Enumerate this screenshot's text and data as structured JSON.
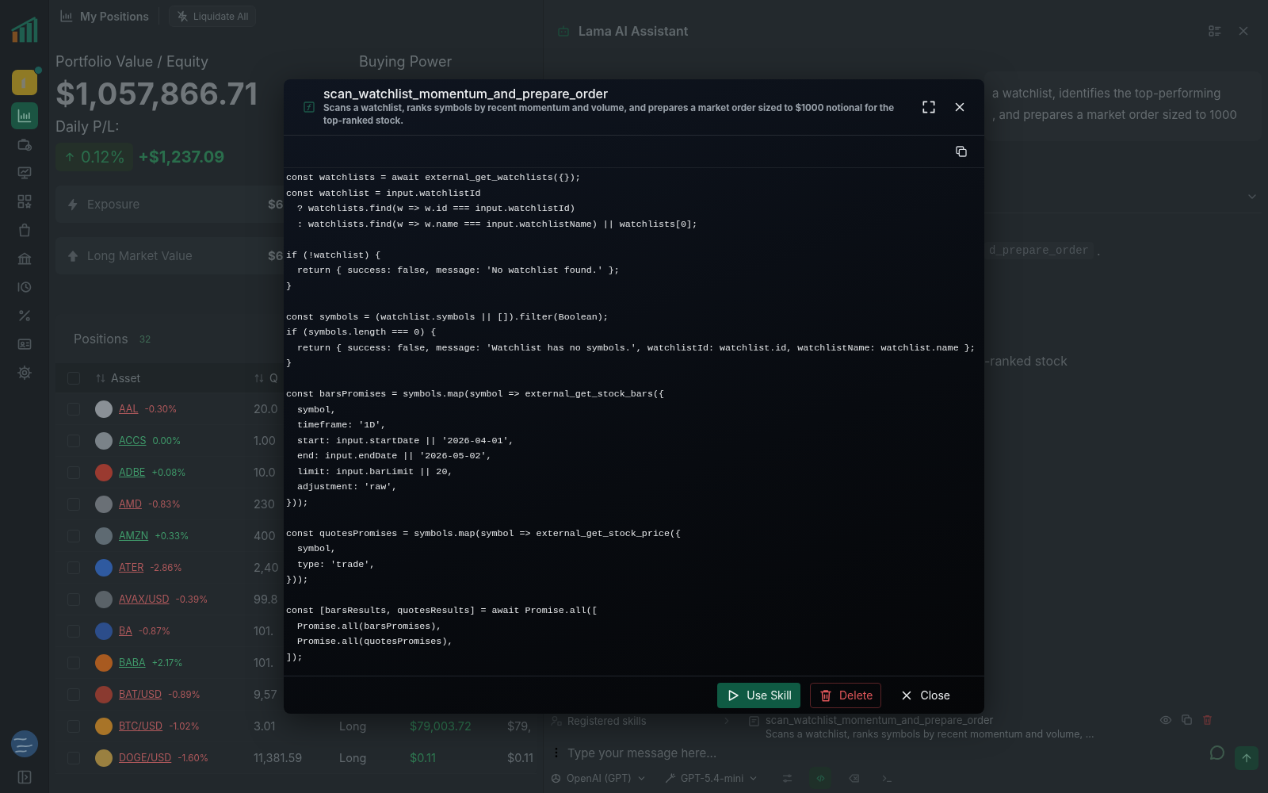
{
  "sidebar": {
    "items": [
      {
        "selected": true
      },
      {
        "selected": false
      },
      {
        "selected": false
      },
      {
        "selected": false
      },
      {
        "selected": false
      },
      {
        "selected": false
      },
      {
        "selected": false
      },
      {
        "selected": false
      },
      {
        "selected": false
      },
      {
        "selected": false
      }
    ]
  },
  "header": {
    "title": "My Positions",
    "liquidate_button": "Liquidate All"
  },
  "portfolio": {
    "label": "Portfolio Value / Equity",
    "value": "$1,057,866.71",
    "daily_label": "Daily P/L:",
    "change_percent": "0.12%",
    "change_amount": "+$1,237.09",
    "buying_power_label": "Buying Power"
  },
  "metrics": [
    {
      "kind": "exposure",
      "label": "Exposure",
      "value": "$6"
    },
    {
      "kind": "long",
      "label": "Long Market Value",
      "value": "$6"
    }
  ],
  "positions": {
    "title": "Positions",
    "count": "32",
    "header_checked": false,
    "columns": [
      "Asset",
      "Q"
    ],
    "rows": [
      {
        "symbol": "AAL",
        "change": "-0.30%",
        "color": "#b0595c",
        "checked": false,
        "quantity": "20.0"
      },
      {
        "symbol": "ACCS",
        "change": "0.00%",
        "color": "#3f9a6a",
        "checked": false,
        "quantity": "1.00"
      },
      {
        "symbol": "ADBE",
        "change": "+0.08%",
        "color": "#3f9a6a",
        "checked": false,
        "quantity": "10.0"
      },
      {
        "symbol": "AMD",
        "change": "-0.83%",
        "color": "#b0595c",
        "checked": false,
        "quantity": "230"
      },
      {
        "symbol": "AMZN",
        "change": "+0.33%",
        "color": "#3f9a6a",
        "checked": false,
        "quantity": "400"
      },
      {
        "symbol": "ATER",
        "change": "-2.86%",
        "color": "#b0595c",
        "checked": false,
        "quantity": "2,40"
      },
      {
        "symbol": "AVAX/USD",
        "change": "-0.39%",
        "color": "#b0595c",
        "checked": false,
        "quantity": "99.8"
      },
      {
        "symbol": "BA",
        "change": "-0.87%",
        "color": "#b0595c",
        "checked": false,
        "quantity": "101."
      },
      {
        "symbol": "BABA",
        "change": "+2.17%",
        "color": "#3f9a6a",
        "checked": false,
        "quantity": "101."
      },
      {
        "symbol": "BAT/USD",
        "change": "-0.89%",
        "color": "#b0595c",
        "checked": false,
        "quantity": "9,57"
      },
      {
        "symbol": "BTC/USD",
        "change": "-1.02%",
        "color": "#b0595c",
        "checked": false,
        "quantity": "3.01",
        "side": "Long",
        "price": "$79,003.72",
        "value": "$79,"
      },
      {
        "symbol": "DOGE/USD",
        "change": "-1.60%",
        "color": "#b0595c",
        "checked": false,
        "quantity": "11,381.59",
        "side": "Long",
        "price": "$0.11",
        "value": "$0.11"
      }
    ]
  },
  "assistant": {
    "title": "Lama AI Assistant",
    "message_lines": [
      "a watchlist, identifies the top-performing",
      ", and prepares a market order sized to 1000"
    ],
    "inline_code": "d_prepare_order",
    "inline_after": ".",
    "ranked_text": "-ranked stock",
    "skills_label": "Registered skills",
    "skill": {
      "name": "scan_watchlist_momentum_and_prepare_order",
      "description": "Scans a watchlist, ranks symbols by recent momentum and volume, ..."
    },
    "input_placeholder": "Type your message here...",
    "provider": "OpenAI (GPT)",
    "model": "GPT-5.4-mini",
    "tools": [
      {
        "selected": false
      },
      {
        "selected": true
      },
      {
        "selected": false
      },
      {
        "selected": false
      }
    ]
  },
  "modal": {
    "title": "scan_watchlist_momentum_and_prepare_order",
    "description": "Scans a watchlist, ranks symbols by recent momentum and volume, and prepares a market order sized to $1000 notional for the top-ranked stock.",
    "code": "const watchlists = await external_get_watchlists({});\nconst watchlist = input.watchlistId\n  ? watchlists.find(w => w.id === input.watchlistId)\n  : watchlists.find(w => w.name === input.watchlistName) || watchlists[0];\n\nif (!watchlist) {\n  return { success: false, message: 'No watchlist found.' };\n}\n\nconst symbols = (watchlist.symbols || []).filter(Boolean);\nif (symbols.length === 0) {\n  return { success: false, message: 'Watchlist has no symbols.', watchlistId: watchlist.id, watchlistName: watchlist.name };\n}\n\nconst barsPromises = symbols.map(symbol => external_get_stock_bars({\n  symbol,\n  timeframe: '1D',\n  start: input.startDate || '2026-04-01',\n  end: input.endDate || '2026-05-02',\n  limit: input.barLimit || 20,\n  adjustment: 'raw',\n}));\n\nconst quotesPromises = symbols.map(symbol => external_get_stock_price({\n  symbol,\n  type: 'trade',\n}));\n\nconst [barsResults, quotesResults] = await Promise.all([\n  Promise.all(barsPromises),\n  Promise.all(quotesPromises),\n]);",
    "buttons": [
      {
        "kind": "use",
        "label": "Use Skill"
      },
      {
        "kind": "delete",
        "label": "Delete"
      },
      {
        "kind": "close",
        "label": "Close"
      }
    ]
  }
}
